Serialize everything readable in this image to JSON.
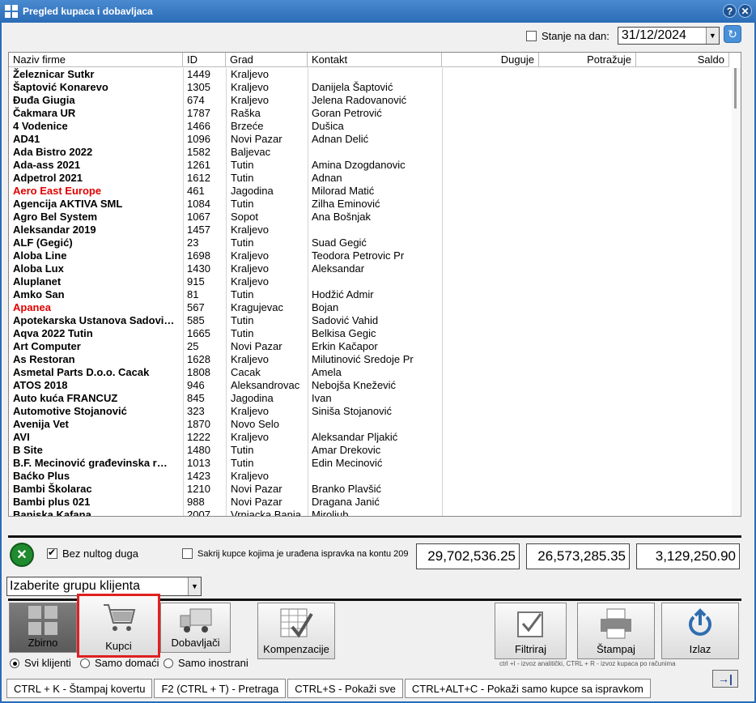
{
  "window": {
    "title": "Pregled kupaca i dobavljaca",
    "help_label": "?",
    "close_label": "✕"
  },
  "date_filter": {
    "label": "Stanje na dan:",
    "checked": false,
    "value": "31/12/2024"
  },
  "grid": {
    "columns": [
      "Naziv firme",
      "ID",
      "Grad",
      "Kontakt",
      "Duguje",
      "Potražuje",
      "Saldo"
    ],
    "rows": [
      {
        "name": "Železnicar Sutkr",
        "id": "1449",
        "city": "Kraljevo",
        "contact": "",
        "red": false
      },
      {
        "name": "Šaptović Konarevo",
        "id": "1305",
        "city": "Kraljevo",
        "contact": "Danijela Šaptović",
        "red": false
      },
      {
        "name": "Đuđa Giugia",
        "id": "674",
        "city": "Kraljevo",
        "contact": "Jelena Radovanović",
        "red": false
      },
      {
        "name": "Čakmara UR",
        "id": "1787",
        "city": "Raška",
        "contact": "Goran Petrović",
        "red": false
      },
      {
        "name": "4 Vodenice",
        "id": "1466",
        "city": "Brzeće",
        "contact": "Dušica",
        "red": false
      },
      {
        "name": "AD41",
        "id": "1096",
        "city": "Novi Pazar",
        "contact": "Adnan Delić",
        "red": false
      },
      {
        "name": "Ada Bistro  2022",
        "id": "1582",
        "city": "Baljevac",
        "contact": "",
        "red": false
      },
      {
        "name": "Ada-ass 2021",
        "id": "1261",
        "city": "Tutin",
        "contact": "Amina Dzogdanovic",
        "red": false
      },
      {
        "name": "Adpetrol 2021",
        "id": "1612",
        "city": "Tutin",
        "contact": "Adnan",
        "red": false
      },
      {
        "name": "Aero East Europe",
        "id": "461",
        "city": "Jagodina",
        "contact": "Milorad Matić",
        "red": true
      },
      {
        "name": "Agencija AKTIVA SML",
        "id": "1084",
        "city": "Tutin",
        "contact": "Zilha Eminović",
        "red": false
      },
      {
        "name": "Agro Bel System",
        "id": "1067",
        "city": "Sopot",
        "contact": "Ana Bošnjak",
        "red": false
      },
      {
        "name": "Aleksandar 2019",
        "id": "1457",
        "city": "Kraljevo",
        "contact": "",
        "red": false
      },
      {
        "name": "ALF (Gegić)",
        "id": "23",
        "city": "Tutin",
        "contact": "Suad Gegić",
        "red": false
      },
      {
        "name": "Aloba Line",
        "id": "1698",
        "city": "Kraljevo",
        "contact": "Teodora Petrovic Pr",
        "red": false
      },
      {
        "name": "Aloba Lux",
        "id": "1430",
        "city": "Kraljevo",
        "contact": "Aleksandar",
        "red": false
      },
      {
        "name": "Aluplanet",
        "id": "915",
        "city": "Kraljevo",
        "contact": "",
        "red": false
      },
      {
        "name": "Amko San",
        "id": "81",
        "city": "Tutin",
        "contact": "Hodžić Admir",
        "red": false
      },
      {
        "name": "Apanea",
        "id": "567",
        "city": "Kragujevac",
        "contact": "Bojan",
        "red": true
      },
      {
        "name": "Apotekarska Ustanova Sadovi…",
        "id": "585",
        "city": "Tutin",
        "contact": "Sadović Vahid",
        "red": false
      },
      {
        "name": "Aqva 2022 Tutin",
        "id": "1665",
        "city": "Tutin",
        "contact": "Belkisa Gegic",
        "red": false
      },
      {
        "name": "Art Computer",
        "id": "25",
        "city": "Novi Pazar",
        "contact": "Erkin Kačapor",
        "red": false
      },
      {
        "name": "As Restoran",
        "id": "1628",
        "city": "Kraljevo",
        "contact": "Milutinović Sredoje Pr",
        "red": false
      },
      {
        "name": "Asmetal Parts D.o.o. Cacak",
        "id": "1808",
        "city": "Cacak",
        "contact": "Amela",
        "red": false
      },
      {
        "name": "ATOS 2018",
        "id": "946",
        "city": "Aleksandrovac",
        "contact": "Nebojša Knežević",
        "red": false
      },
      {
        "name": "Auto kuća FRANCUZ",
        "id": "845",
        "city": "Jagodina",
        "contact": "Ivan",
        "red": false
      },
      {
        "name": "Automotive Stojanović",
        "id": "323",
        "city": "Kraljevo",
        "contact": "Siniša Stojanović",
        "red": false
      },
      {
        "name": "Avenija Vet",
        "id": "1870",
        "city": "Novo Selo",
        "contact": "",
        "red": false
      },
      {
        "name": "AVI",
        "id": "1222",
        "city": "Kraljevo",
        "contact": "Aleksandar Pljakić",
        "red": false
      },
      {
        "name": "B Site",
        "id": "1480",
        "city": "Tutin",
        "contact": "Amar Drekovic",
        "red": false
      },
      {
        "name": "B.F. Mecinović građevinska r…",
        "id": "1013",
        "city": "Tutin",
        "contact": "Edin Mecinović",
        "red": false
      },
      {
        "name": "Baćko Plus",
        "id": "1423",
        "city": "Kraljevo",
        "contact": "",
        "red": false
      },
      {
        "name": "Bambi Školarac",
        "id": "1210",
        "city": "Novi Pazar",
        "contact": "Branko Plavšić",
        "red": false
      },
      {
        "name": "Bambi plus 021",
        "id": "988",
        "city": "Novi Pazar",
        "contact": "Dragana Janić",
        "red": false
      },
      {
        "name": "Banjska Kafana",
        "id": "2007",
        "city": "Vrnjacka Banja",
        "contact": "Miroljub",
        "red": false
      }
    ]
  },
  "options": {
    "zero_debt": {
      "label": "Bez nultog duga",
      "checked": true
    },
    "hide_corrected": {
      "label": "Sakrij kupce kojima je urađena ispravka na kontu 209",
      "checked": false
    }
  },
  "totals": {
    "duguje": "29,702,536.25",
    "potrazuje": "26,573,285.35",
    "saldo": "3,129,250.90"
  },
  "group_select": {
    "value": "Izaberite grupu klijenta"
  },
  "buttons": {
    "zbirno": "Zbirno",
    "kupci": "Kupci",
    "dobavljaci": "Dobavljači",
    "kompenzacije": "Kompenzacije",
    "filtriraj": "Filtriraj",
    "stampaj": "Štampaj",
    "izlaz": "Izlaz"
  },
  "radios": {
    "svi": "Svi klijenti",
    "domaci": "Samo domaći",
    "inostrani": "Samo inostrani",
    "selected": "svi"
  },
  "hint": "ctrl +I - izvoz analitički, CTRL + R - izvoz kupaca po računima",
  "status": [
    "CTRL + K  - Štampaj kovertu",
    "F2 (CTRL + T) - Pretraga",
    "CTRL+S - Pokaži sve",
    "CTRL+ALT+C - Pokaži samo kupce sa ispravkom"
  ],
  "colors": {
    "titlebar": "#2a6cb6",
    "highlight": "#e02020",
    "red_client": "#e00000"
  }
}
